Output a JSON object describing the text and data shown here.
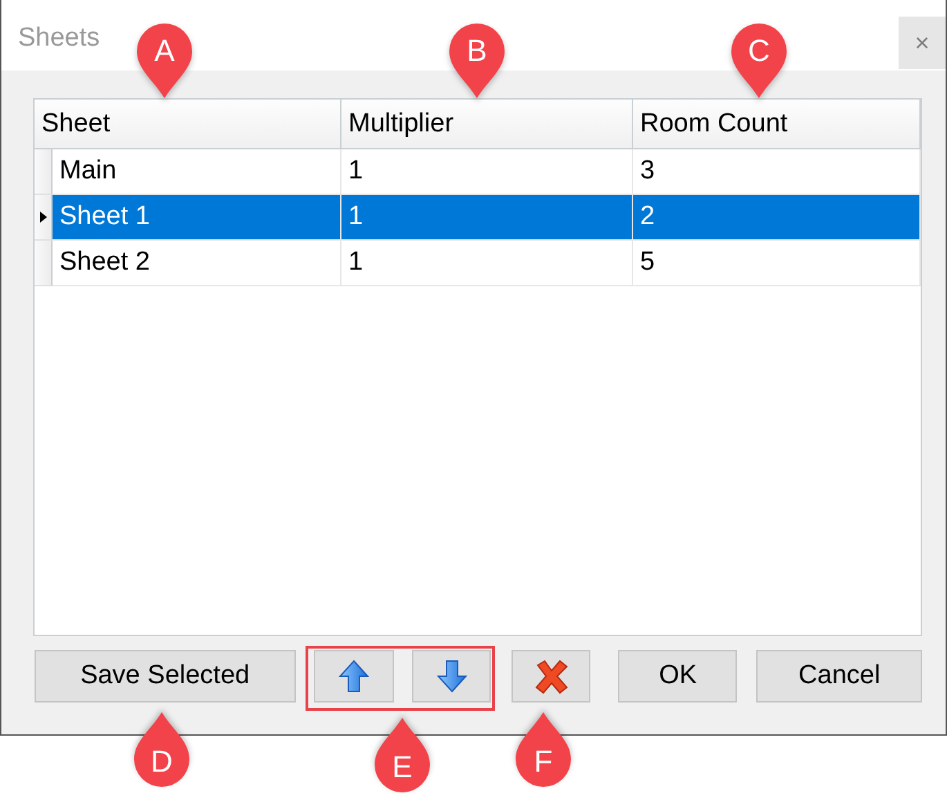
{
  "window": {
    "title": "Sheets",
    "close_label": "×"
  },
  "table": {
    "columns": [
      "Sheet",
      "Multiplier",
      "Room Count"
    ],
    "rows": [
      {
        "cells": [
          "Main",
          "1",
          "3"
        ],
        "selected": false
      },
      {
        "cells": [
          "Sheet 1",
          "1",
          "2"
        ],
        "selected": true
      },
      {
        "cells": [
          "Sheet 2",
          "1",
          "5"
        ],
        "selected": false
      }
    ]
  },
  "buttons": [
    {
      "kind": "text",
      "label": "Save Selected"
    },
    {
      "kind": "up"
    },
    {
      "kind": "down"
    },
    {
      "kind": "delete"
    },
    {
      "kind": "text",
      "label": "OK"
    },
    {
      "kind": "text",
      "label": "Cancel"
    }
  ],
  "callouts": [
    {
      "label": "A",
      "kind": "down"
    },
    {
      "label": "B",
      "kind": "down"
    },
    {
      "label": "C",
      "kind": "down"
    },
    {
      "label": "D",
      "kind": "up"
    },
    {
      "label": "E",
      "kind": "up"
    },
    {
      "label": "F",
      "kind": "up"
    }
  ]
}
